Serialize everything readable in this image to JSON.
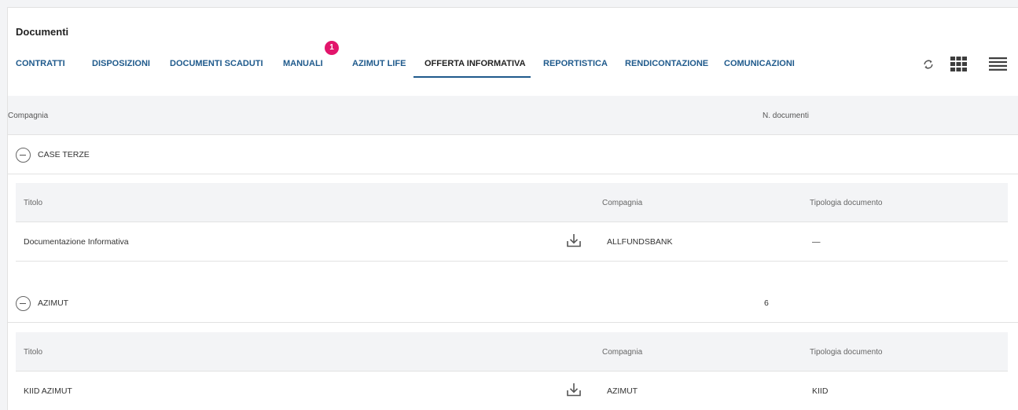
{
  "page": {
    "title": "Documenti"
  },
  "tabs": [
    {
      "label": "CONTRATTI"
    },
    {
      "label": "DISPOSIZIONI"
    },
    {
      "label": "DOCUMENTI SCADUTI"
    },
    {
      "label": "MANUALI",
      "badge": "1"
    },
    {
      "label": "AZIMUT LIFE"
    },
    {
      "label": "OFFERTA INFORMATIVA",
      "active": true
    },
    {
      "label": "REPORTISTICA"
    },
    {
      "label": "RENDICONTAZIONE"
    },
    {
      "label": "COMUNICAZIONI"
    }
  ],
  "toolbar": {
    "icons": [
      "refresh-icon",
      "grid-view-icon",
      "list-view-icon"
    ]
  },
  "table": {
    "columns": {
      "company": "Compagnia",
      "doc_count": "N. documenti"
    },
    "groups": [
      {
        "name": "CASE TERZE",
        "count": "",
        "sub_columns": {
          "title": "Titolo",
          "company": "Compagnia",
          "doc_type": "Tipologia documento"
        },
        "rows": [
          {
            "title": "Documentazione Informativa",
            "company": "ALLFUNDSBANK",
            "doc_type": "—"
          }
        ]
      },
      {
        "name": "AZIMUT",
        "count": "6",
        "sub_columns": {
          "title": "Titolo",
          "company": "Compagnia",
          "doc_type": "Tipologia documento"
        },
        "rows": [
          {
            "title": "KIID AZIMUT",
            "company": "AZIMUT",
            "doc_type": "KIID"
          }
        ]
      }
    ]
  },
  "colors": {
    "accent": "#1f5a8c",
    "badge": "#e2156b",
    "header_bg": "#f3f4f6"
  }
}
